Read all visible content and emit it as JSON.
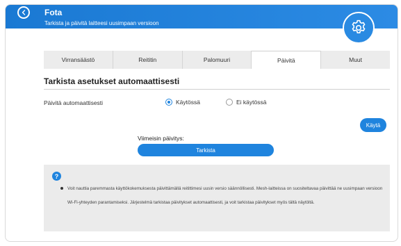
{
  "header": {
    "title": "Fota",
    "subtitle": "Tarkista ja päivitä laitteesi uusimpaan versioon"
  },
  "tabs": [
    {
      "label": "Virransäästö",
      "active": false
    },
    {
      "label": "Reititin",
      "active": false
    },
    {
      "label": "Palomuuri",
      "active": false
    },
    {
      "label": "Päivitä",
      "active": true
    },
    {
      "label": "Muut",
      "active": false
    }
  ],
  "auto": {
    "section_title": "Tarkista asetukset automaattisesti",
    "row_label": "Päivitä automaattisesti",
    "option_on": "Käytössä",
    "option_off": "Ei käytössä",
    "selected": "Käytössä",
    "apply_label": "Käytä"
  },
  "update": {
    "last_label": "Viimeisin päivitys:",
    "check_label": "Tarkista"
  },
  "info": {
    "icon": "?",
    "text": "Voit nauttia paremmasta käyttökokemuksesta päivittämällä reitittimesi uusin versio säännöllisesti. Mesh-laitteissa on suositeltavaa päivittää ne uusimpaan versioon Wi-Fi-yhteyden parantamiseksi. Järjestelmä tarkistaa päivitykset automaattisesti, ja voit tarkistaa päivitykset myös tältä näytöltä."
  },
  "icons": {
    "back": "chevron-left-icon",
    "settings": "gear-icon",
    "info": "help-icon"
  },
  "colors": {
    "accent": "#1f84de",
    "header": "#1a79d3",
    "info_bg": "#ebebeb"
  }
}
